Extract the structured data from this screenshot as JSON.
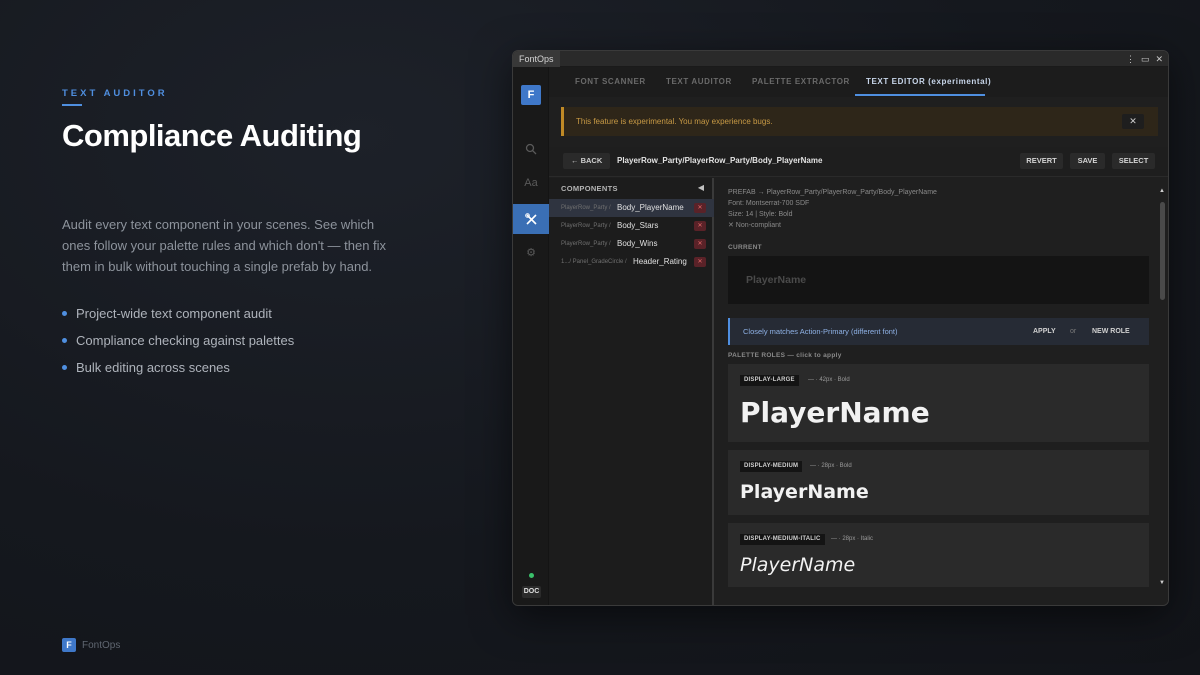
{
  "hero": {
    "eyebrow": "TEXT AUDITOR",
    "headline": "Compliance Auditing",
    "description": "Audit every text component in your scenes. See which ones follow your palette rules and which don't — then fix them in bulk without touching a single prefab by hand.",
    "bullets": [
      "Project-wide text component audit",
      "Compliance checking against palettes",
      "Bulk editing across scenes"
    ]
  },
  "footer": {
    "logo_letter": "F",
    "brand": "FontOps"
  },
  "window": {
    "title": "FontOps",
    "controls": [
      "⋮",
      "▭",
      "✕"
    ]
  },
  "sidebar": {
    "logo_letter": "F",
    "items": [
      {
        "icon": "search-icon",
        "glyph": "⌕"
      },
      {
        "icon": "font-icon",
        "glyph": "Aa"
      },
      {
        "icon": "tools-icon",
        "glyph": "✕"
      },
      {
        "icon": "gear-icon",
        "glyph": "⚙"
      }
    ],
    "doc_label": "DOC"
  },
  "nav": {
    "tabs": [
      "FONT SCANNER",
      "TEXT AUDITOR",
      "PALETTE EXTRACTOR",
      "TEXT EDITOR (experimental)"
    ]
  },
  "warning": {
    "text": "This feature is experimental. You may experience bugs.",
    "close": "✕"
  },
  "pathbar": {
    "back": "← BACK",
    "path": "PlayerRow_Party/PlayerRow_Party/Body_PlayerName",
    "revert": "REVERT",
    "save": "SAVE",
    "select": "SELECT"
  },
  "components": {
    "header": "COMPONENTS",
    "collapse": "◀",
    "rows": [
      {
        "prefix": "PlayerRow_Party /",
        "name": "Body_PlayerName",
        "badge": "✕"
      },
      {
        "prefix": "PlayerRow_Party /",
        "name": "Body_Stars",
        "badge": "✕"
      },
      {
        "prefix": "PlayerRow_Party /",
        "name": "Body_Wins",
        "badge": "✕"
      },
      {
        "prefix": "1.../ Panel_GradeCircle /",
        "name": "Header_Rating",
        "badge": "✕"
      }
    ]
  },
  "detail": {
    "prefab_line": "PREFAB → PlayerRow_Party/PlayerRow_Party/Body_PlayerName",
    "font_line": "Font: Montserrat-700 SDF",
    "size_line": "Size: 14  |  Style: Bold",
    "status_line": "✕ Non-compliant",
    "current_label": "CURRENT",
    "current_sample": "PlayerName",
    "suggestion": {
      "text": "Closely matches Action-Primary (different font)",
      "apply": "APPLY",
      "or": "or",
      "new_role": "NEW ROLE"
    },
    "palette_label": "PALETTE ROLES — click to apply",
    "roles": [
      {
        "tag": "DISPLAY-LARGE",
        "meta": "— · 42px · Bold",
        "sample": "PlayerName"
      },
      {
        "tag": "DISPLAY-MEDIUM",
        "meta": "— · 28px · Bold",
        "sample": "PlayerName"
      },
      {
        "tag": "DISPLAY-MEDIUM-ITALIC",
        "meta": "— · 28px · Italic",
        "sample": "PlayerName"
      }
    ],
    "scroll_up": "▲",
    "scroll_down": "▼"
  },
  "colors": {
    "accent": "#4f8fe0",
    "warning": "#c08a26",
    "error_badge": "#5a2228",
    "status_ok": "#3ac06a"
  }
}
